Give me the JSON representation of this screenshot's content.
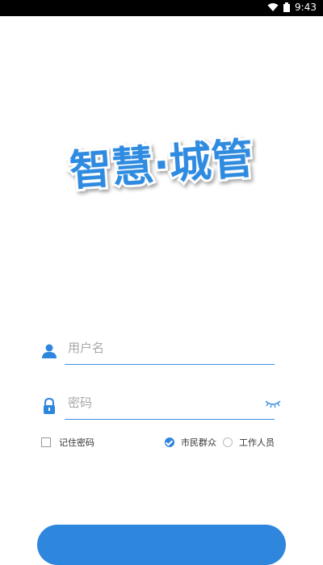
{
  "status_bar": {
    "time": "9:43"
  },
  "logo": {
    "text": "智慧·城管"
  },
  "form": {
    "username_placeholder": "用户名",
    "password_placeholder": "密码",
    "remember_label": "记住密码",
    "role_citizen_label": "市民群众",
    "role_staff_label": "工作人员",
    "remember_checked": false,
    "selected_role": "市民群众"
  },
  "colors": {
    "accent": "#2f86dd",
    "logo_fill": "#2f8be0"
  }
}
